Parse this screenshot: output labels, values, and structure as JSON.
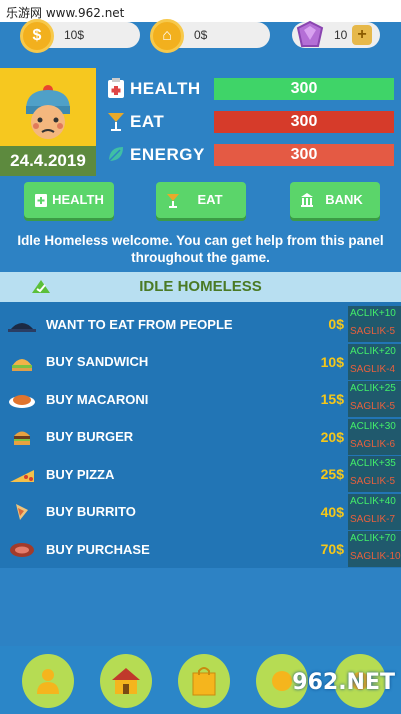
{
  "watermark": "乐游网 www.962.net",
  "currency": {
    "money": "10$",
    "gold": "0$",
    "gems": "10",
    "gems_plus": "+"
  },
  "profile": {
    "date": "24.4.2019"
  },
  "stats": [
    {
      "label": "HEALTH",
      "value": "300",
      "color": "#3fd468"
    },
    {
      "label": "EAT",
      "value": "300",
      "color": "#d63b2a"
    },
    {
      "label": "ENERGY",
      "value": "300",
      "color": "#e45a44"
    }
  ],
  "nav": {
    "health": "HEALTH",
    "eat": "EAT",
    "bank": "BANK"
  },
  "welcome": "Idle Homeless welcome. You can get help from this panel throughout the game.",
  "list_title": "IDLE HOMELESS",
  "items": [
    {
      "name": "WANT TO EAT FROM PEOPLE",
      "price": "0$",
      "plus": "ACLIK+10",
      "minus": "SAGLIK-5",
      "icon": "hat-icon"
    },
    {
      "name": "BUY SANDWICH",
      "price": "10$",
      "plus": "ACLIK+20",
      "minus": "SAGLIK-4",
      "icon": "sandwich-icon"
    },
    {
      "name": "BUY MACARONI",
      "price": "15$",
      "plus": "ACLIK+25",
      "minus": "SAGLIK-5",
      "icon": "macaroni-icon"
    },
    {
      "name": "BUY BURGER",
      "price": "20$",
      "plus": "ACLIK+30",
      "minus": "SAGLIK-6",
      "icon": "burger-icon"
    },
    {
      "name": "BUY PIZZA",
      "price": "25$",
      "plus": "ACLIK+35",
      "minus": "SAGLIK-5",
      "icon": "pizza-icon"
    },
    {
      "name": "BUY BURRITO",
      "price": "40$",
      "plus": "ACLIK+40",
      "minus": "SAGLIK-7",
      "icon": "burrito-icon"
    },
    {
      "name": "BUY PURCHASE",
      "price": "70$",
      "plus": "ACLIK+70",
      "minus": "SAGLIK-10",
      "icon": "steak-icon"
    }
  ],
  "site_logo": "962.NET"
}
